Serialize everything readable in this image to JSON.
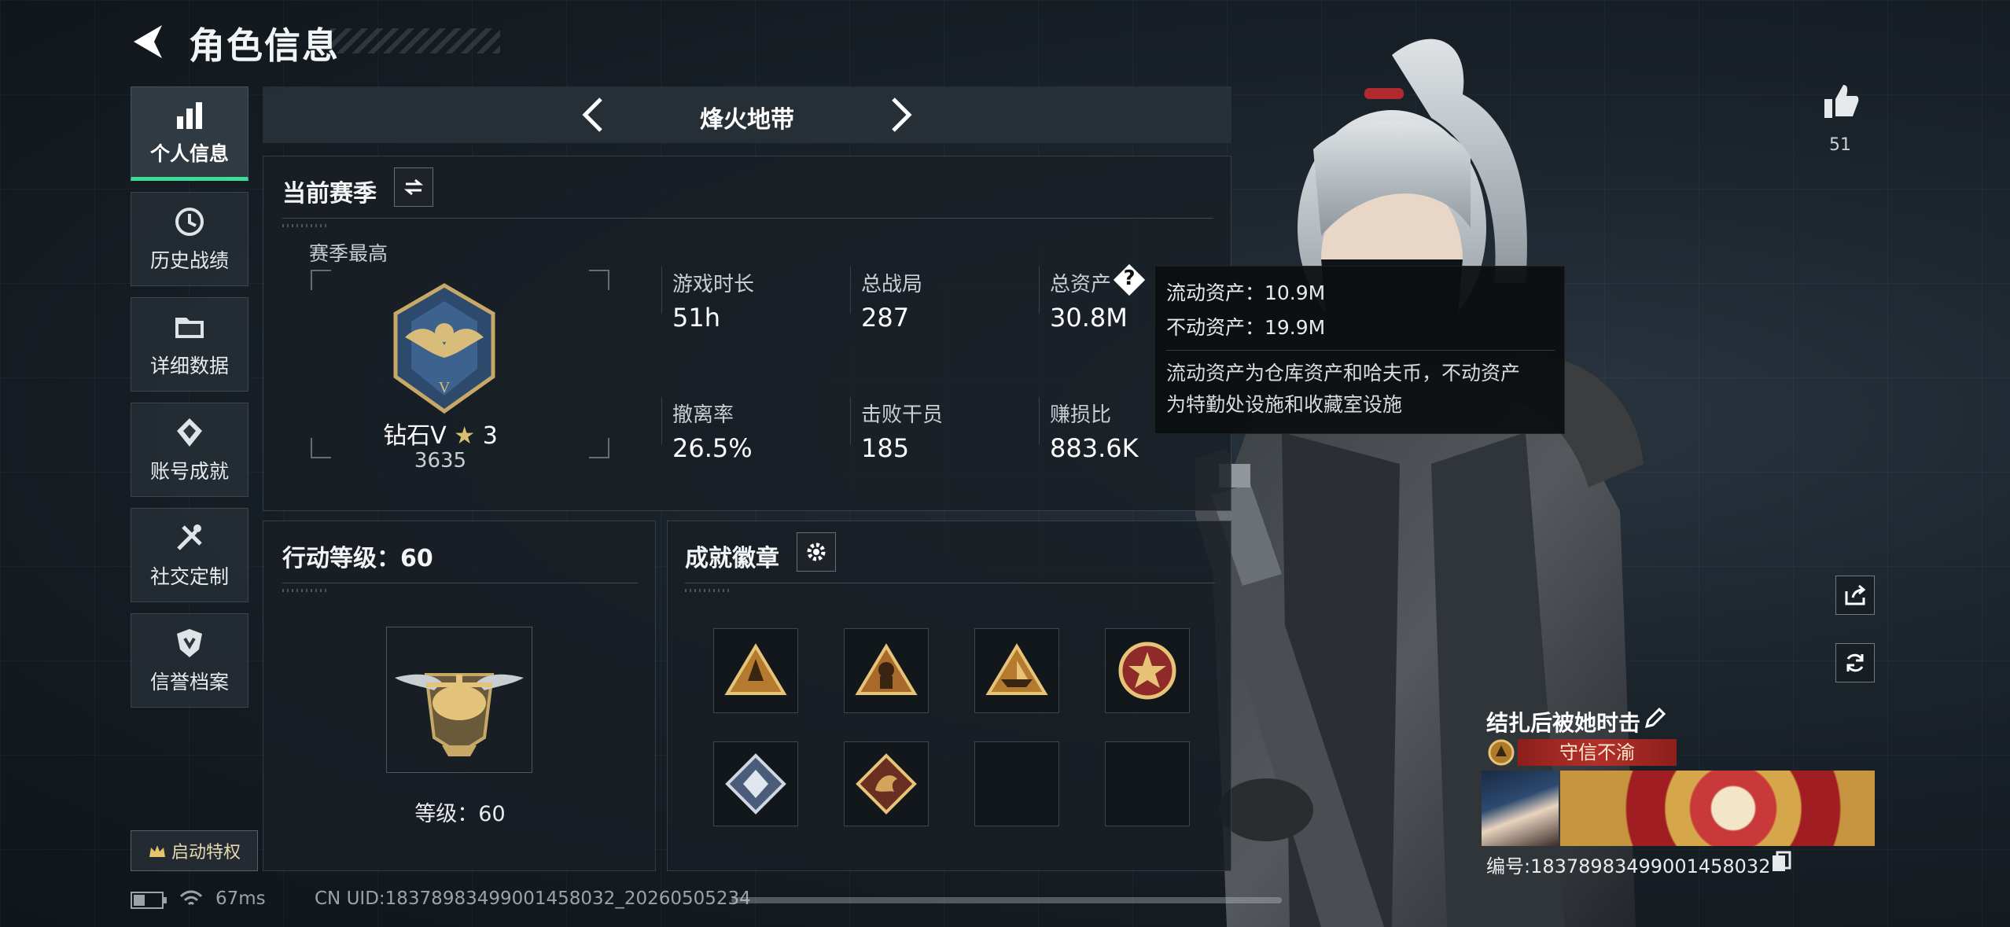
{
  "header": {
    "title": "角色信息"
  },
  "nav": {
    "items": [
      {
        "label": "个人信息",
        "icon": "bar-chart-icon",
        "active": true
      },
      {
        "label": "历史战绩",
        "icon": "history-icon"
      },
      {
        "label": "详细数据",
        "icon": "folder-icon"
      },
      {
        "label": "账号成就",
        "icon": "achievement-icon"
      },
      {
        "label": "社交定制",
        "icon": "tools-icon"
      },
      {
        "label": "信誉档案",
        "icon": "credit-shield-icon"
      }
    ],
    "privilege_label": "启动特权"
  },
  "mode": {
    "title": "烽火地带"
  },
  "season": {
    "heading": "当前赛季",
    "best_label": "赛季最高",
    "rank_name": "钻石V",
    "rank_stars": "3",
    "rank_score": "3635",
    "stats": [
      {
        "label": "游戏时长",
        "value": "51h"
      },
      {
        "label": "总战局",
        "value": "287"
      },
      {
        "label": "总资产",
        "value": "30.8M"
      },
      {
        "label": "撤离率",
        "value": "26.5%"
      },
      {
        "label": "击败干员",
        "value": "185"
      },
      {
        "label": "赚损比",
        "value": "883.6K"
      }
    ]
  },
  "tooltip": {
    "liquid": "流动资产：10.9M",
    "fixed": "不动资产：19.9M",
    "desc_line1": "流动资产为仓库资产和哈夫币，不动资产",
    "desc_line2": "为特勤处设施和收藏室设施"
  },
  "level": {
    "heading": "行动等级：60",
    "label": "等级：60"
  },
  "badges": {
    "heading": "成就徽章",
    "slots_filled": 6,
    "slots_total": 8
  },
  "social": {
    "likes": "51"
  },
  "player": {
    "name": "结扎后被她时击",
    "title": "守信不渝",
    "id_text": "编号:18378983499001458032"
  },
  "status": {
    "latency": "67ms",
    "uid": "CN UID:18378983499001458032_20260505234"
  },
  "colors": {
    "accent": "#3ddc97",
    "gold": "#d6a64a",
    "title_red": "#b3302a"
  }
}
